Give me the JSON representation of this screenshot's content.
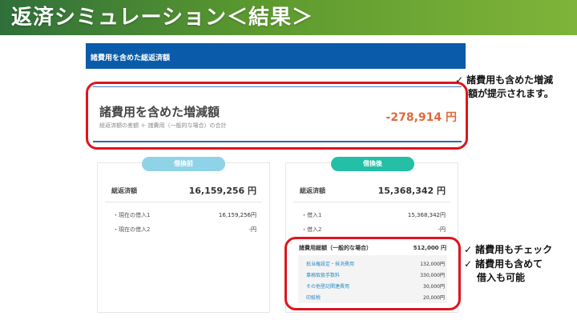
{
  "slide": {
    "title": "返済シミュレーション＜結果＞"
  },
  "panel": {
    "header": "諸費用を含めた総返済額"
  },
  "summary": {
    "heading": "諸費用を含めた増減額",
    "note": "総返済額の差額 ＋ 諸費用（一般的な場合）の合計",
    "value": "-278,914 円"
  },
  "before": {
    "badge": "借換前",
    "total_label": "総返済額",
    "total_value": "16,159,256 円",
    "loans": [
      {
        "label": "・現在の借入1",
        "value": "16,159,256円"
      },
      {
        "label": "・現在の借入2",
        "value": "-円"
      }
    ]
  },
  "after": {
    "badge": "借換後",
    "total_label": "総返済額",
    "total_value": "15,368,342 円",
    "loans": [
      {
        "label": "・借入1",
        "value": "15,368,342円"
      },
      {
        "label": "・借入2",
        "value": "-円"
      }
    ],
    "fees_label": "諸費用総額（一般的な場合）",
    "fees_value": "512,000 円",
    "fees": [
      {
        "label": "抵当権設定・抹消費用",
        "value": "132,000円"
      },
      {
        "label": "事務取扱手数料",
        "value": "330,000円"
      },
      {
        "label": "その他登記関連費用",
        "value": "30,000円"
      },
      {
        "label": "印紙税",
        "value": "20,000円"
      }
    ]
  },
  "notes": {
    "top_line1": "諸費用も含めた増減",
    "top_line2": "額が提示されます。",
    "bottom_line1": "諸費用もチェック",
    "bottom_line2": "諸費用も含めて",
    "bottom_line3": "借入も可能",
    "check": "✓"
  },
  "colors": {
    "header_green": "#5c9a2e",
    "panel_blue": "#0a5cab",
    "callout_red": "#e0141e",
    "value_orange": "#e2683a",
    "badge_before": "#8fd3e8",
    "badge_after": "#24bfa6",
    "fee_label_blue": "#2d8ac7"
  }
}
